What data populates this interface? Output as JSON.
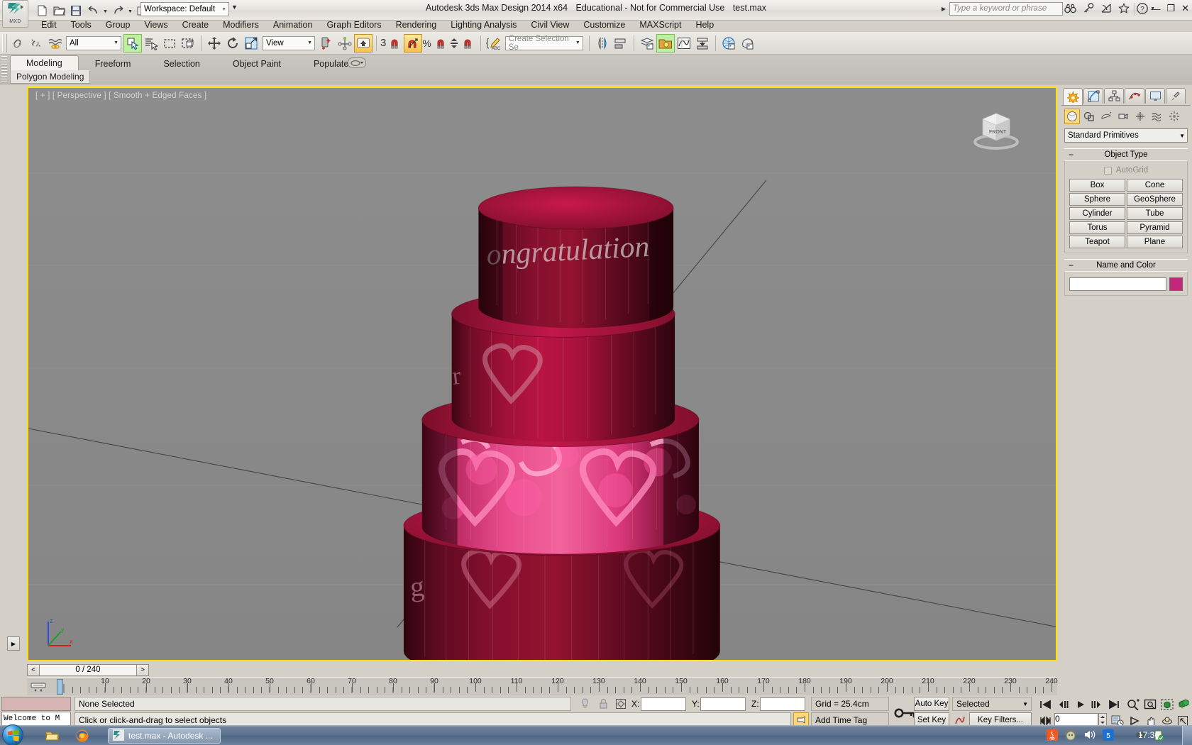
{
  "titlebar": {
    "app_title": "Autodesk 3ds Max Design 2014 x64",
    "license": "Educational - Not for Commercial Use",
    "filename": "test.max",
    "workspace_label": "Workspace: Default",
    "search_placeholder": "Type a keyword or phrase",
    "quick_access": [
      {
        "name": "new-icon",
        "label": "New"
      },
      {
        "name": "open-icon",
        "label": "Open"
      },
      {
        "name": "save-icon",
        "label": "Save"
      },
      {
        "name": "undo-icon",
        "label": "Undo"
      },
      {
        "name": "redo-icon",
        "label": "Redo"
      },
      {
        "name": "project-folder-icon",
        "label": "Set Project Folder"
      }
    ],
    "window_buttons": {
      "minimize": "—",
      "maximize": "❐",
      "close": "✕"
    },
    "help_label": "?"
  },
  "menubar": {
    "items": [
      "Edit",
      "Tools",
      "Group",
      "Views",
      "Create",
      "Modifiers",
      "Animation",
      "Graph Editors",
      "Rendering",
      "Lighting Analysis",
      "Civil View",
      "Customize",
      "MAXScript",
      "Help"
    ]
  },
  "toolbar": {
    "selection_filter": "All",
    "reference_coord": "View",
    "named_selection_sets": "Create Selection Se",
    "angle_snap_value": "3",
    "tools": [
      {
        "name": "select-link-icon",
        "label": "Select and Link"
      },
      {
        "name": "unlink-selection-icon",
        "label": "Unlink Selection"
      },
      {
        "name": "bind-to-space-warp-icon",
        "label": "Bind to Space Warp"
      },
      {
        "name": "select-object-icon",
        "label": "Select Object"
      },
      {
        "name": "select-by-name-icon",
        "label": "Select by Name"
      },
      {
        "name": "rectangular-selection-region-icon",
        "label": "Rectangular Selection Region"
      },
      {
        "name": "window-crossing-icon",
        "label": "Window / Crossing"
      },
      {
        "name": "select-and-move-icon",
        "label": "Select and Move"
      },
      {
        "name": "select-and-rotate-icon",
        "label": "Select and Rotate"
      },
      {
        "name": "select-and-scale-icon",
        "label": "Select and Uniform Scale"
      },
      {
        "name": "select-and-place-icon",
        "label": "Select and Place"
      },
      {
        "name": "use-center-flyout-icon",
        "label": "Use Pivot Point Center"
      },
      {
        "name": "select-and-manipulate-icon",
        "label": "Select and Manipulate"
      },
      {
        "name": "snaps-toggle-icon",
        "label": "Snaps Toggle"
      },
      {
        "name": "angle-snap-toggle-icon",
        "label": "Angle Snap Toggle"
      },
      {
        "name": "percent-snap-toggle-icon",
        "label": "Percent Snap Toggle"
      },
      {
        "name": "spinner-snap-toggle-icon",
        "label": "Spinner Snap Toggle"
      },
      {
        "name": "edit-named-selection-sets-icon",
        "label": "Edit Named Selection Sets"
      },
      {
        "name": "mirror-icon",
        "label": "Mirror"
      },
      {
        "name": "align-icon",
        "label": "Align"
      },
      {
        "name": "layer-explorer-icon",
        "label": "Layer Explorer"
      },
      {
        "name": "scene-explorer-icon",
        "label": "Toggle Scene Explorer"
      },
      {
        "name": "curve-editor-icon",
        "label": "Curve Editor"
      },
      {
        "name": "schematic-view-icon",
        "label": "Schematic View"
      },
      {
        "name": "material-editor-icon",
        "label": "Material Editor"
      },
      {
        "name": "render-setup-icon",
        "label": "Render Setup"
      }
    ]
  },
  "ribbon": {
    "tabs": [
      "Modeling",
      "Freeform",
      "Selection",
      "Object Paint",
      "Populate"
    ],
    "active_tab": "Modeling",
    "panel_label": "Polygon Modeling"
  },
  "viewport": {
    "label": "[ + ] [ Perspective ] [ Smooth + Edged Faces ]",
    "viewcube_face": "FRONT",
    "axis": {
      "x": "x",
      "y": "y",
      "z": "z"
    },
    "background_color": "#8a8a8a",
    "border_color": "#ffe400"
  },
  "command_panel": {
    "tabs": [
      {
        "name": "create-tab",
        "label": "Create"
      },
      {
        "name": "modify-tab",
        "label": "Modify"
      },
      {
        "name": "hierarchy-tab",
        "label": "Hierarchy"
      },
      {
        "name": "motion-tab",
        "label": "Motion"
      },
      {
        "name": "display-tab",
        "label": "Display"
      },
      {
        "name": "utilities-tab",
        "label": "Utilities"
      }
    ],
    "active_tab": "Create",
    "categories": [
      {
        "name": "geometry-category-icon",
        "label": "Geometry"
      },
      {
        "name": "shapes-category-icon",
        "label": "Shapes"
      },
      {
        "name": "lights-category-icon",
        "label": "Lights"
      },
      {
        "name": "cameras-category-icon",
        "label": "Cameras"
      },
      {
        "name": "helpers-category-icon",
        "label": "Helpers"
      },
      {
        "name": "space-warps-category-icon",
        "label": "Space Warps"
      },
      {
        "name": "systems-category-icon",
        "label": "Systems"
      }
    ],
    "active_category": "Geometry",
    "subcategory": "Standard Primitives",
    "object_type": {
      "title": "Object Type",
      "autogrid_label": "AutoGrid",
      "buttons": [
        "Box",
        "Cone",
        "Sphere",
        "GeoSphere",
        "Cylinder",
        "Tube",
        "Torus",
        "Pyramid",
        "Teapot",
        "Plane"
      ]
    },
    "name_and_color": {
      "title": "Name and Color",
      "name_value": "",
      "color": "#c4267c"
    }
  },
  "time_slider": {
    "current_frame_label": "0 / 240",
    "prev_label": "<",
    "next_label": ">",
    "range_start": 0,
    "range_end": 240,
    "ruler_ticks": [
      10,
      20,
      30,
      40,
      50,
      60,
      70,
      80,
      90,
      100,
      110,
      120,
      130,
      140,
      150,
      160,
      170,
      180,
      190,
      200,
      210,
      220,
      230,
      240
    ]
  },
  "status_bar": {
    "selection_status": "None Selected",
    "prompt": "Click or click-and-drag to select objects",
    "mini_listener_text": "Welcome to M",
    "coordinates": {
      "x_label": "X:",
      "y_label": "Y:",
      "z_label": "Z:",
      "x_value": "",
      "y_value": "",
      "z_value": ""
    },
    "grid_label": "Grid = 25.4cm",
    "add_time_tag": "Add Time Tag",
    "auto_key": "Auto Key",
    "set_key": "Set Key",
    "key_mode": "Selected",
    "key_filters": "Key Filters...",
    "key_field_value": "0",
    "nav_icons": [
      {
        "name": "go-to-start-icon"
      },
      {
        "name": "previous-frame-icon"
      },
      {
        "name": "play-animation-icon"
      },
      {
        "name": "next-frame-icon"
      },
      {
        "name": "go-to-end-icon"
      },
      {
        "name": "zoom-icon"
      },
      {
        "name": "zoom-all-icon"
      },
      {
        "name": "zoom-extents-icon"
      },
      {
        "name": "zoom-extents-all-icon"
      },
      {
        "name": "key-mode-toggle-icon"
      },
      {
        "name": "time-configuration-icon"
      },
      {
        "name": "field-of-view-icon"
      },
      {
        "name": "pan-view-icon"
      },
      {
        "name": "orbit-icon"
      },
      {
        "name": "maximize-viewport-toggle-icon"
      }
    ]
  },
  "taskbar": {
    "start_label": "Start",
    "quick_launch": [
      {
        "name": "explorer-icon",
        "label": "Windows Explorer"
      },
      {
        "name": "firefox-icon",
        "label": "Mozilla Firefox"
      }
    ],
    "task_item": "test.max - Autodesk ...",
    "tray_icons": [
      {
        "name": "java-icon"
      },
      {
        "name": "headphones-icon"
      },
      {
        "name": "volume-icon"
      },
      {
        "name": "security-shield-icon"
      },
      {
        "name": "optical-disc-icon"
      },
      {
        "name": "battery-ok-icon"
      }
    ],
    "clock": "17:36"
  }
}
